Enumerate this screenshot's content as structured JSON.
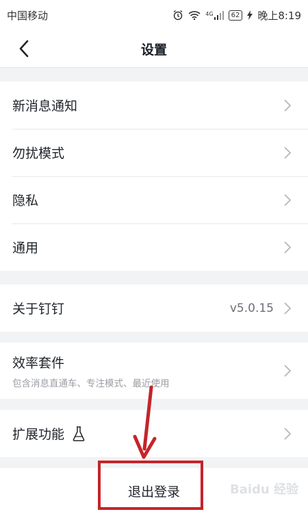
{
  "status": {
    "carrier": "中国移动",
    "network": "4G",
    "battery": "62",
    "time": "晚上8:19"
  },
  "header": {
    "title": "设置"
  },
  "settings": {
    "group1": [
      {
        "label": "新消息通知"
      },
      {
        "label": "勿扰模式"
      },
      {
        "label": "隐私"
      },
      {
        "label": "通用"
      }
    ],
    "about": {
      "label": "关于钉钉",
      "value": "v5.0.15"
    },
    "suite": {
      "label": "效率套件",
      "description": "包含消息直通车、专注模式、最近使用"
    },
    "extensions": {
      "label": "扩展功能"
    },
    "logout": {
      "label": "退出登录"
    }
  },
  "annotation": {
    "color": "#c4242a"
  },
  "watermark": {
    "text": "Baidu 经验"
  }
}
